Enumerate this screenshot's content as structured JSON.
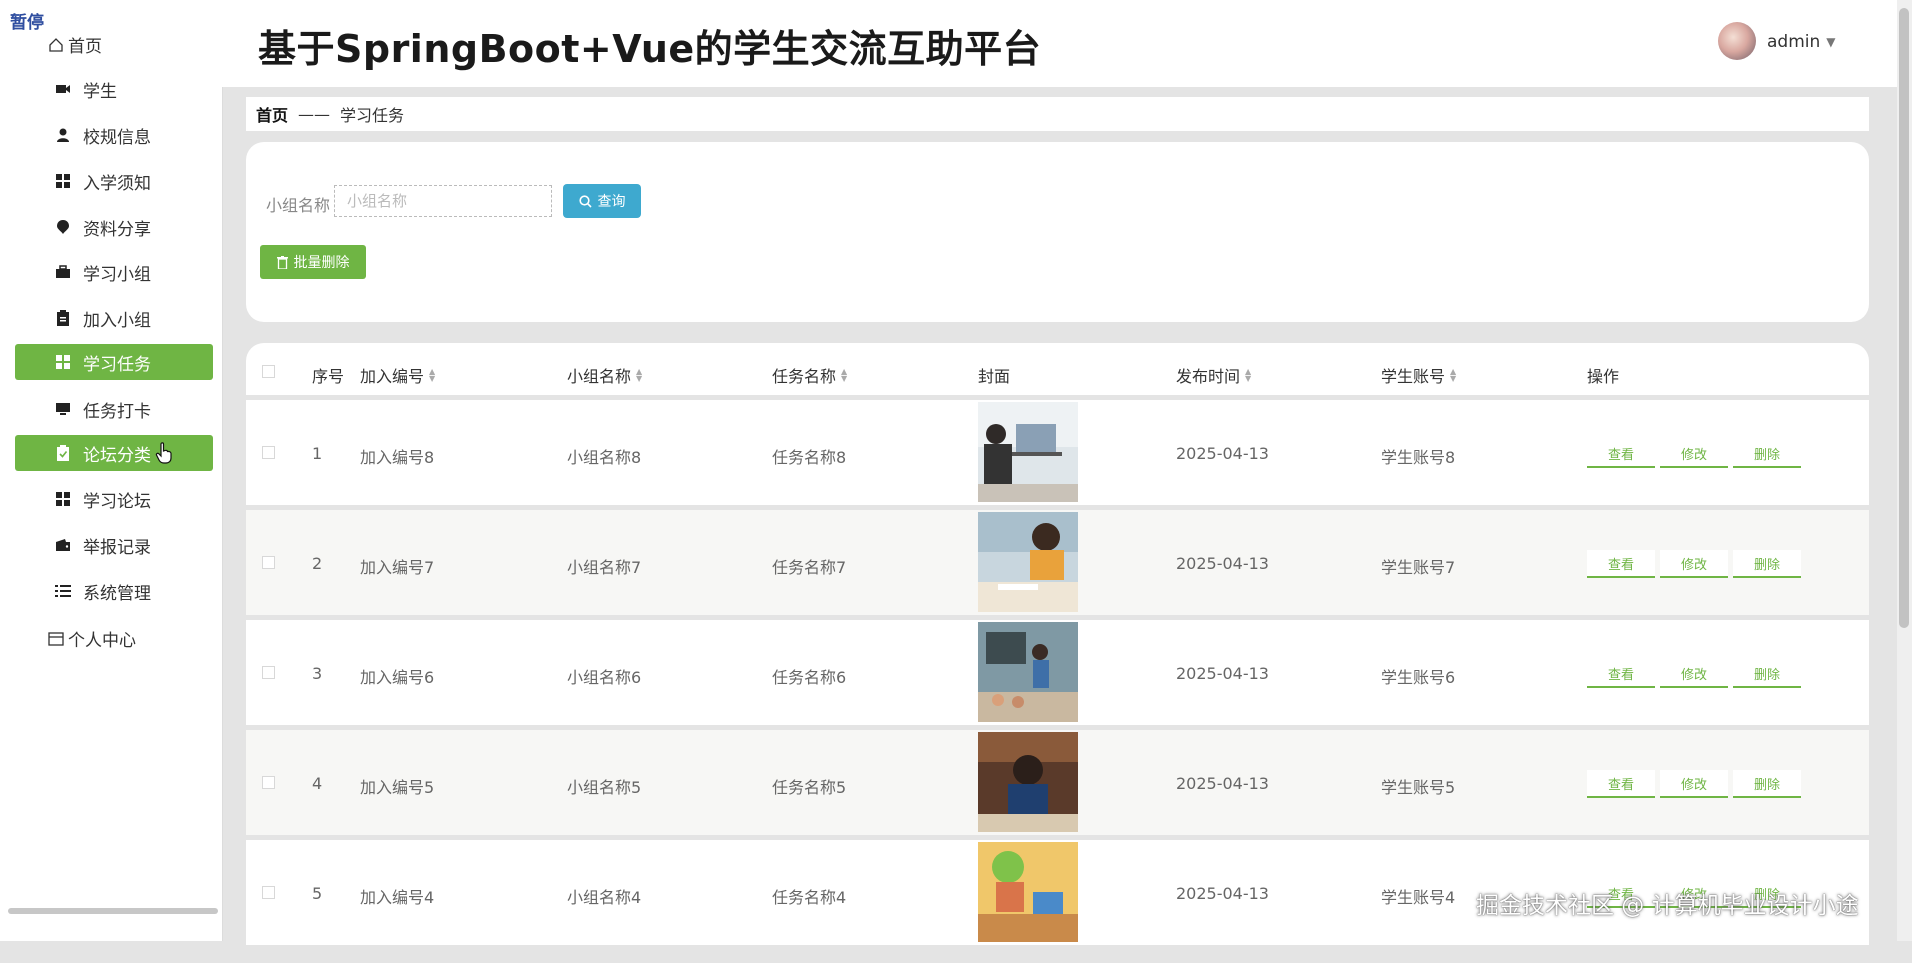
{
  "status": {
    "paused": "暂停"
  },
  "header": {
    "title": "基于SpringBoot+Vue的学生交流互助平台",
    "user": "admin"
  },
  "sidebar": {
    "home": "首页",
    "items": [
      {
        "label": "学生",
        "icon": "camera-icon"
      },
      {
        "label": "校规信息",
        "icon": "user-icon"
      },
      {
        "label": "入学须知",
        "icon": "grid-icon"
      },
      {
        "label": "资料分享",
        "icon": "pin-icon"
      },
      {
        "label": "学习小组",
        "icon": "briefcase-icon"
      },
      {
        "label": "加入小组",
        "icon": "clipboard-icon"
      },
      {
        "label": "学习任务",
        "icon": "grid-icon"
      },
      {
        "label": "任务打卡",
        "icon": "monitor-icon"
      },
      {
        "label": "论坛分类",
        "icon": "clipboard-check-icon"
      },
      {
        "label": "学习论坛",
        "icon": "grid-icon"
      },
      {
        "label": "举报记录",
        "icon": "wallet-icon"
      },
      {
        "label": "系统管理",
        "icon": "list-icon"
      }
    ],
    "profile": "个人中心",
    "active_color": "#6fb544"
  },
  "breadcrumb": {
    "home": "首页",
    "separator": "——",
    "current": "学习任务"
  },
  "search": {
    "label": "小组名称",
    "placeholder": "小组名称",
    "button": "查询",
    "batch_delete": "批量删除"
  },
  "table": {
    "headers": [
      "序号",
      "加入编号",
      "小组名称",
      "任务名称",
      "封面",
      "发布时间",
      "学生账号",
      "操作"
    ],
    "rows": [
      {
        "index": "1",
        "join_no": "加入编号8",
        "group": "小组名称8",
        "task": "任务名称8",
        "time": "2025-04-13",
        "account": "学生账号8"
      },
      {
        "index": "2",
        "join_no": "加入编号7",
        "group": "小组名称7",
        "task": "任务名称7",
        "time": "2025-04-13",
        "account": "学生账号7"
      },
      {
        "index": "3",
        "join_no": "加入编号6",
        "group": "小组名称6",
        "task": "任务名称6",
        "time": "2025-04-13",
        "account": "学生账号6"
      },
      {
        "index": "4",
        "join_no": "加入编号5",
        "group": "小组名称5",
        "task": "任务名称5",
        "time": "2025-04-13",
        "account": "学生账号5"
      },
      {
        "index": "5",
        "join_no": "加入编号4",
        "group": "小组名称4",
        "task": "任务名称4",
        "time": "2025-04-13",
        "account": "学生账号4"
      }
    ],
    "ops": {
      "view": "查看",
      "edit": "修改",
      "delete": "删除"
    }
  },
  "watermark": "掘金技术社区 @ 计算机毕业设计小途",
  "colors": {
    "primary_green": "#6fb544",
    "search_blue": "#3ea9cf"
  }
}
